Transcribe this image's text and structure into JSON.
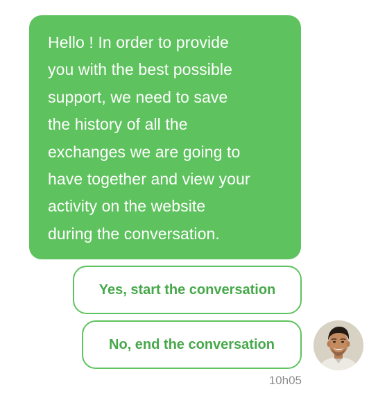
{
  "message": {
    "lines": [
      "Hello ! In order to provide",
      "you with the best possible",
      "support, we need to save",
      "the history of all the",
      "exchanges we are going to",
      "have together and view your",
      "activity on the website",
      "during the conversation."
    ]
  },
  "choices": {
    "yes_label": "Yes, start the conversation",
    "no_label": "No, end the conversation"
  },
  "timestamp": "10h05",
  "colors": {
    "accent": "#5ec25e",
    "button_text": "#46a84a",
    "timestamp_text": "#8d8d8d"
  },
  "icons": {
    "avatar": "agent-avatar-photo"
  }
}
